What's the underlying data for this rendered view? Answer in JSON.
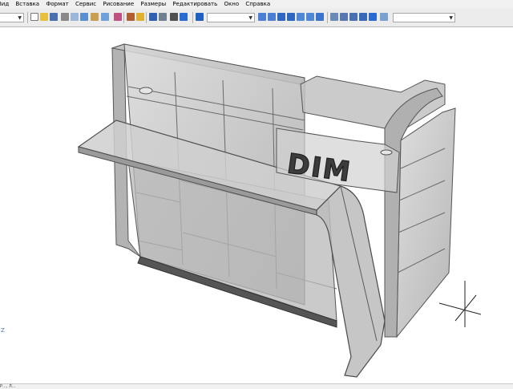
{
  "menu": {
    "items": [
      "Вид",
      "Вставка",
      "Формат",
      "Сервис",
      "Рисование",
      "Размеры",
      "Редактировать",
      "Окно",
      "Справка"
    ]
  },
  "toolbar": {
    "icons": [
      "new-icon",
      "open-icon",
      "save-icon",
      "print-icon",
      "cut-icon",
      "copy-icon",
      "paste-icon",
      "brush-icon",
      "pencil-icon",
      "undo-icon",
      "redo-icon",
      "zoom-icon",
      "view-icon",
      "shade-icon",
      "render-icon"
    ]
  },
  "viewport": {
    "brand_text": "DIM",
    "ucs_label": "Z"
  },
  "status": {
    "text": "Р..., Л..."
  },
  "colors": {
    "panel": "#c9c9c9",
    "edge": "#5a5a5a",
    "accent": "#2a6bd1"
  }
}
